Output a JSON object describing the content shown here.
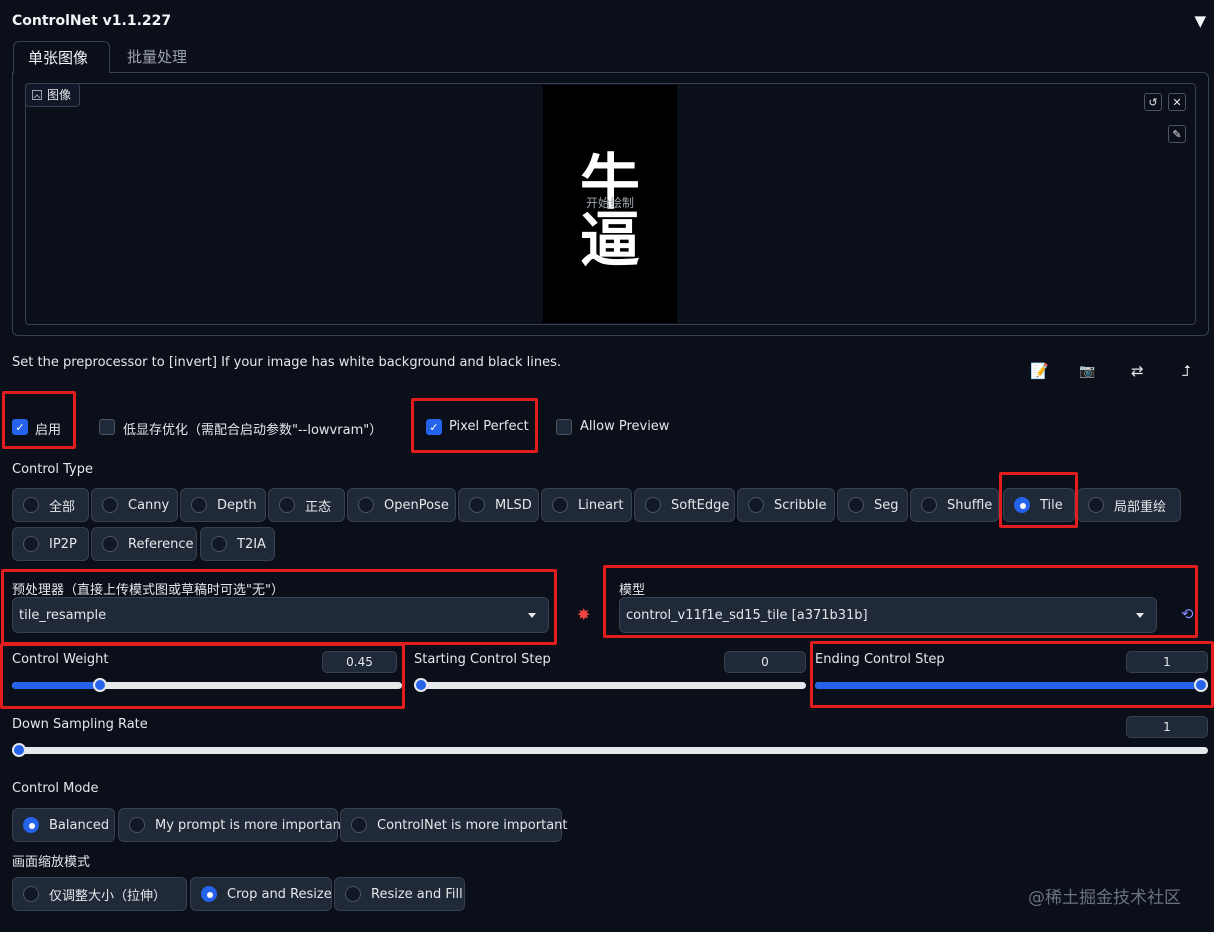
{
  "panel": {
    "title": "ControlNet v1.1.227",
    "collapse_icon": "▼"
  },
  "tabs": [
    {
      "label": "单张图像",
      "active": true
    },
    {
      "label": "批量处理",
      "active": false
    }
  ],
  "image": {
    "label": "图像",
    "canvas_chars": [
      "牛",
      "逼"
    ],
    "overlay_text": "开始绘制",
    "buttons": {
      "reset": "↺",
      "close": "✕",
      "brush": "✎"
    }
  },
  "hint": "Set the preprocessor to [invert] If your image has white background and black lines.",
  "tools": [
    "📝",
    "📷",
    "⇄",
    "⮥"
  ],
  "checkboxes": [
    {
      "label": "启用",
      "checked": true
    },
    {
      "label": "低显存优化（需配合启动参数\"--lowvram\"）",
      "checked": false
    },
    {
      "label": "Pixel Perfect",
      "checked": true
    },
    {
      "label": "Allow Preview",
      "checked": false
    }
  ],
  "control_type": {
    "label": "Control Type",
    "options": [
      "全部",
      "Canny",
      "Depth",
      "正态",
      "OpenPose",
      "MLSD",
      "Lineart",
      "SoftEdge",
      "Scribble",
      "Seg",
      "Shuffle",
      "Tile",
      "局部重绘",
      "IP2P",
      "Reference",
      "T2IA"
    ],
    "selected": "Tile"
  },
  "preprocessor": {
    "label": "预处理器（直接上传模式图或草稿时可选\"无\"）",
    "value": "tile_resample"
  },
  "model": {
    "label": "模型",
    "value": "control_v11f1e_sd15_tile [a371b31b]"
  },
  "run_icon": "✸",
  "refresh_icon": "⟲",
  "sliders": {
    "control_weight": {
      "label": "Control Weight",
      "value": "0.45",
      "fraction": 0.225
    },
    "starting_step": {
      "label": "Starting Control Step",
      "value": "0",
      "fraction": 0
    },
    "ending_step": {
      "label": "Ending Control Step",
      "value": "1",
      "fraction": 1
    },
    "down_sampling": {
      "label": "Down Sampling Rate",
      "value": "1",
      "fraction": 0
    }
  },
  "control_mode": {
    "label": "Control Mode",
    "options": [
      "Balanced",
      "My prompt is more important",
      "ControlNet is more important"
    ],
    "selected": "Balanced"
  },
  "resize_mode": {
    "label": "画面缩放模式",
    "options": [
      "仅调整大小（拉伸）",
      "Crop and Resize",
      "Resize and Fill"
    ],
    "selected": "Crop and Resize"
  },
  "watermark": "@稀土掘金技术社区",
  "colors": {
    "accent": "#2563eb",
    "highlight": "#e11d1d",
    "background": "#0b0f19"
  }
}
